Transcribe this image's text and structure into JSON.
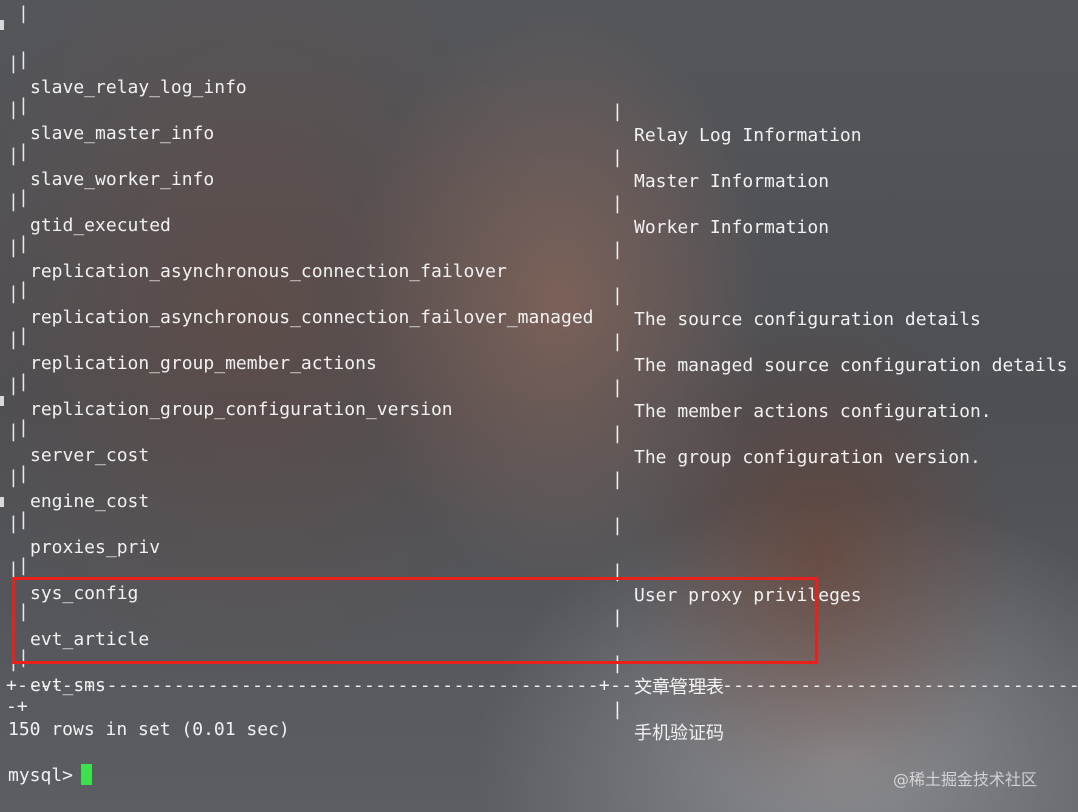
{
  "terminal": {
    "rows": [
      {
        "name": "slave_relay_log_info",
        "comment": "Relay Log Information"
      },
      {
        "name": "slave_master_info",
        "comment": "Master Information"
      },
      {
        "name": "slave_worker_info",
        "comment": "Worker Information"
      },
      {
        "name": "gtid_executed",
        "comment": ""
      },
      {
        "name": "replication_asynchronous_connection_failover",
        "comment": "The source configuration details"
      },
      {
        "name": "replication_asynchronous_connection_failover_managed",
        "comment": "The managed source configuration details"
      },
      {
        "name": "replication_group_member_actions",
        "comment": "The member actions configuration."
      },
      {
        "name": "replication_group_configuration_version",
        "comment": "The group configuration version."
      },
      {
        "name": "server_cost",
        "comment": ""
      },
      {
        "name": "engine_cost",
        "comment": ""
      },
      {
        "name": "proxies_priv",
        "comment": "User proxy privileges"
      },
      {
        "name": "sys_config",
        "comment": ""
      },
      {
        "name": "evt_article",
        "comment": "文章管理表"
      },
      {
        "name": "evt_sms",
        "comment": "手机验证码"
      }
    ],
    "separator": "+----------------------------------------------------+--------------------------------------------",
    "separator_tail": "-+",
    "summary": "150 rows in set (0.01 sec)",
    "prompt": "mysql>"
  },
  "watermark": "@稀土掘金技术社区",
  "colors": {
    "text": "#f1f1f1",
    "cursor": "#3fe04e",
    "highlight": "#e8211b"
  }
}
